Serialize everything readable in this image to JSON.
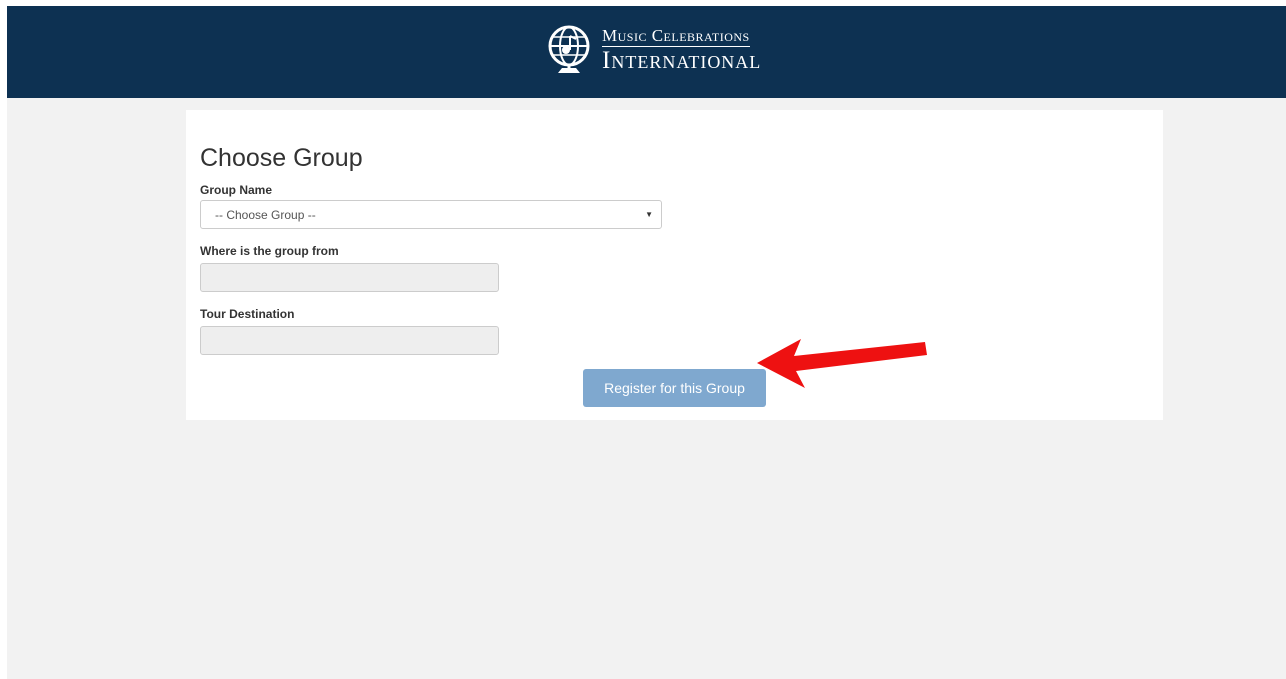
{
  "logo": {
    "line1": "Music Celebrations",
    "line2": "International",
    "icon": "globe-music-icon"
  },
  "form": {
    "title": "Choose Group",
    "group_name_label": "Group Name",
    "group_select_value": "-- Choose Group --",
    "group_from_label": "Where is the group from",
    "group_from_value": "",
    "tour_destination_label": "Tour Destination",
    "tour_destination_value": "",
    "submit_label": "Register for this Group"
  },
  "colors": {
    "header_bg": "#0d3152",
    "page_bg": "#f2f2f2",
    "button_bg": "#7fa8cf",
    "annotation_arrow": "#ee1111"
  }
}
